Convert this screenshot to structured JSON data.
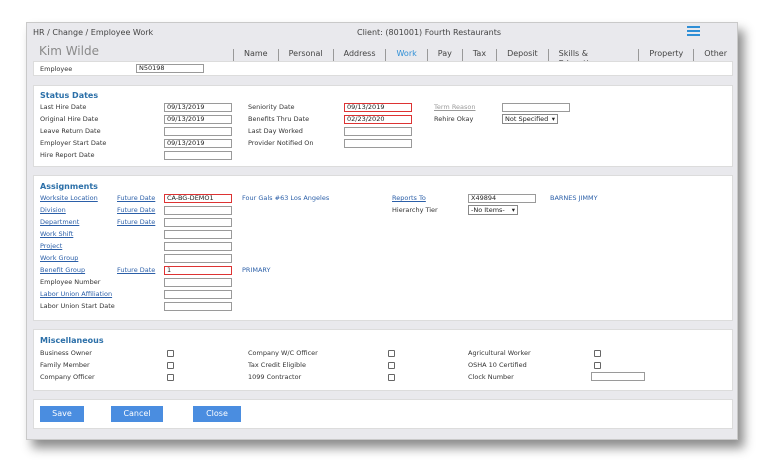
{
  "header": {
    "breadcrumb": "HR / Change / Employee Work",
    "client": "Client: (801001) Fourth Restaurants",
    "employee_name": "Kim Wilde"
  },
  "tabs": [
    {
      "label": "Name"
    },
    {
      "label": "Personal"
    },
    {
      "label": "Address"
    },
    {
      "label": "Work"
    },
    {
      "label": "Pay"
    },
    {
      "label": "Tax"
    },
    {
      "label": "Deposit"
    },
    {
      "label": "Skills & Education"
    },
    {
      "label": "Property"
    },
    {
      "label": "Other"
    }
  ],
  "active_tab": "Work",
  "employee": {
    "label": "Employee",
    "value": "N50198"
  },
  "status": {
    "title": "Status Dates",
    "last_hire_date": {
      "label": "Last Hire Date",
      "value": "09/13/2019"
    },
    "original_hire_date": {
      "label": "Original Hire Date",
      "value": "09/13/2019"
    },
    "leave_return_date": {
      "label": "Leave Return Date",
      "value": ""
    },
    "employer_start_date": {
      "label": "Employer Start Date",
      "value": "09/13/2019"
    },
    "hire_report_date": {
      "label": "Hire Report Date",
      "value": ""
    },
    "seniority_date": {
      "label": "Seniority Date",
      "value": "09/13/2019"
    },
    "benefits_thru_date": {
      "label": "Benefits Thru Date",
      "value": "02/23/2020"
    },
    "last_day_worked": {
      "label": "Last Day Worked",
      "value": ""
    },
    "provider_notified_on": {
      "label": "Provider Notified On",
      "value": ""
    },
    "term_reason": {
      "label": "Term Reason",
      "value": ""
    },
    "rehire_okay": {
      "label": "Rehire Okay",
      "value": "Not Specified"
    }
  },
  "assignments": {
    "title": "Assignments",
    "future_date_label": "Future Date",
    "worksite_location": {
      "label": "Worksite Location",
      "value": "CA-BG-DEMO1",
      "desc": "Four Gals #63 Los Angeles"
    },
    "division": {
      "label": "Division",
      "value": ""
    },
    "department": {
      "label": "Department",
      "value": ""
    },
    "work_shift": {
      "label": "Work Shift",
      "value": ""
    },
    "project": {
      "label": "Project",
      "value": ""
    },
    "work_group": {
      "label": "Work Group",
      "value": ""
    },
    "benefit_group": {
      "label": "Benefit Group",
      "value": "1",
      "desc": "PRIMARY"
    },
    "employee_number": {
      "label": "Employee Number",
      "value": ""
    },
    "labor_union_affiliation": {
      "label": "Labor Union Affiliation",
      "value": ""
    },
    "labor_union_start_date": {
      "label": "Labor Union Start Date",
      "value": ""
    },
    "reports_to": {
      "label": "Reports To",
      "value": "X49894",
      "desc": "BARNES JIMMY"
    },
    "hierarchy_tier": {
      "label": "Hierarchy Tier",
      "value": "-No Items-"
    }
  },
  "misc": {
    "title": "Miscellaneous",
    "business_owner": "Business Owner",
    "family_member": "Family Member",
    "company_officer": "Company Officer",
    "company_wc_officer": "Company W/C Officer",
    "tax_credit_eligible": "Tax Credit Eligible",
    "contractor_1099": "1099 Contractor",
    "agricultural_worker": "Agricultural Worker",
    "osha_10_certified": "OSHA 10 Certified",
    "clock_number": {
      "label": "Clock Number",
      "value": ""
    }
  },
  "buttons": {
    "save": "Save",
    "cancel": "Cancel",
    "close": "Close"
  },
  "colors": {
    "accent": "#4a8de0",
    "link": "#2b5fa8",
    "error_border": "#dd3333"
  }
}
